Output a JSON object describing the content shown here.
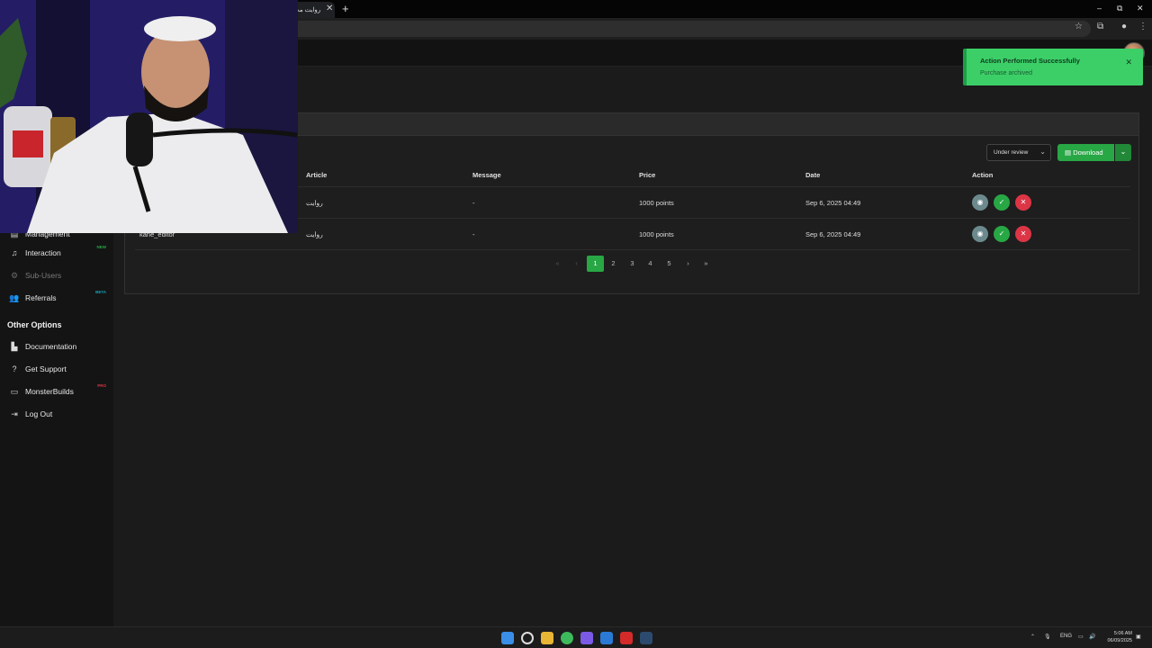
{
  "browser": {
    "tab_title": "روايت مث",
    "tab_close": "✕",
    "new_tab": "+",
    "window_controls": [
      "–",
      "⧉",
      "✕"
    ],
    "omnibar_icons": [
      "star-icon",
      "extensions-icon",
      "profile-icon",
      "menu-icon"
    ]
  },
  "toast": {
    "title": "Action Performed Successfully",
    "message": "Purchase archived",
    "close": "✕"
  },
  "sidebar": {
    "partial_item": "Management",
    "items": [
      {
        "label": "Interaction",
        "icon": "music-note-icon",
        "badge": "NEW",
        "badge_color": "#28a745"
      },
      {
        "label": "Sub-Users",
        "icon": "users-cog-icon",
        "dimmed": true
      },
      {
        "label": "Referrals",
        "icon": "user-group-icon",
        "badge": "BETA",
        "badge_color": "#17a2b8"
      }
    ],
    "other_heading": "Other Options",
    "other_items": [
      {
        "label": "Documentation",
        "icon": "book-icon"
      },
      {
        "label": "Get Support",
        "icon": "question-circle-icon"
      },
      {
        "label": "MonsterBuilds",
        "icon": "laptop-icon",
        "badge": "PRO",
        "badge_color": "#dc3545"
      },
      {
        "label": "Log Out",
        "icon": "sign-out-icon"
      }
    ]
  },
  "toolbar": {
    "filter_value": "Under review",
    "download_label": "Download"
  },
  "table": {
    "headers": [
      "Article",
      "Message",
      "Price",
      "Date",
      "Action"
    ],
    "rows": [
      {
        "user": "",
        "article": "روايت",
        "message": "-",
        "price": "1000 points",
        "date": "Sep 6, 2025 04:49"
      },
      {
        "user": "kane_editor",
        "article": "روايت",
        "message": "-",
        "price": "1000 points",
        "date": "Sep 6, 2025 04:49"
      }
    ]
  },
  "pagination": {
    "first": "«",
    "prev": "‹",
    "pages": [
      "1",
      "2",
      "3",
      "4",
      "5"
    ],
    "active_page": "1",
    "next": "›",
    "last": "»"
  },
  "taskbar": {
    "tray_lang": "ENG",
    "time": "5:06 AM",
    "date": "06/09/2025"
  },
  "colors": {
    "accent_green": "#28a745",
    "danger_red": "#dc3545",
    "view_grey": "#6c8a8e",
    "toast_green": "#3ccf68"
  }
}
